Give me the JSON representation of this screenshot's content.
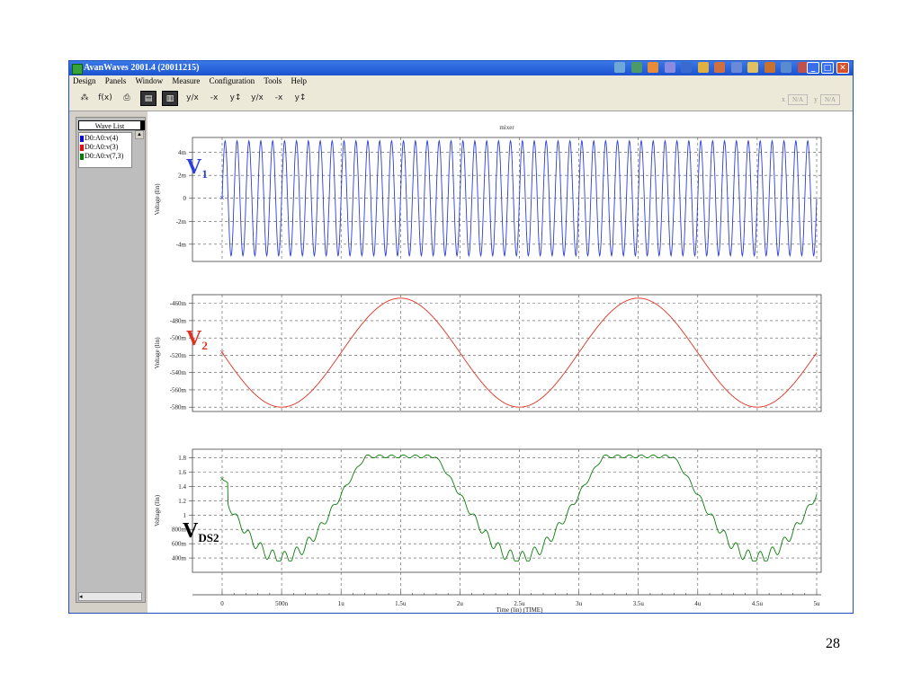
{
  "window": {
    "title": "AvanWaves 2001.4 (20011215)",
    "min_label": "_",
    "max_label": "□",
    "close_label": "✕"
  },
  "menu": [
    "Design",
    "Panels",
    "Window",
    "Measure",
    "Configuration",
    "Tools",
    "Help"
  ],
  "toolbar": {
    "icons": [
      "tree-icon",
      "function-icon",
      "print-icon",
      "export-icon",
      "import-icon",
      "cursor-y-x-icon",
      "cursor-x-icon",
      "cursor-y-icon",
      "cursor-y-x2-icon",
      "cursor-x2-icon",
      "cursor-y2-icon"
    ],
    "coord_x_label": "x",
    "coord_x_value": "N/A",
    "coord_y_label": "y",
    "coord_y_value": "N/A"
  },
  "wave_list": {
    "title": "Wave List",
    "items": [
      {
        "label": "D0:A0:v(4)",
        "color": "#0000ff"
      },
      {
        "label": "D0:A0:v(3)",
        "color": "#ff0000"
      },
      {
        "label": "D0:A0:v(7,3)",
        "color": "#008000"
      }
    ]
  },
  "chart_data": {
    "type": "line",
    "title": "mixer",
    "xlabel": "Time (lin) (TIME)",
    "xlim": [
      0,
      5
    ],
    "x_unit": "u",
    "x_ticks": [
      "0",
      "500n",
      "1u",
      "1.5u",
      "2u",
      "2.5u",
      "3u",
      "3.5u",
      "4u",
      "4.5u",
      "5u"
    ],
    "panels": [
      {
        "series": "D0:A0:v(4)",
        "annotation": "V1",
        "annotation_main": "V",
        "annotation_sub": "1",
        "color": "#2b3fd8",
        "ylabel": "Voltage (lin)",
        "yticks": [
          "4m",
          "2m",
          "0",
          "-2m",
          "-4m"
        ],
        "ylim": [
          -5.5,
          5.3
        ],
        "ytick_values": [
          4,
          2,
          0,
          -2,
          -4
        ],
        "signal": {
          "kind": "sine",
          "amplitude_mV": 5,
          "frequency_MHz": 10,
          "offset_mV": 0
        }
      },
      {
        "series": "D0:A0:v(3)",
        "annotation": "V2",
        "annotation_main": "V",
        "annotation_sub": "2",
        "color": "#e03020",
        "ylabel": "Voltage (lin)",
        "yticks": [
          "-460m",
          "-480m",
          "-500m",
          "-520m",
          "-540m",
          "-560m",
          "-580m"
        ],
        "ylim": [
          -585,
          -450
        ],
        "ytick_values": [
          -460,
          -480,
          -500,
          -520,
          -540,
          -560,
          -580
        ],
        "signal": {
          "kind": "sine",
          "center_mV": -517,
          "amplitude_mV": 63,
          "period_us": 2,
          "peak_us": 1.5
        }
      },
      {
        "series": "D0:A0:v(7,3)",
        "annotation": "VDS2",
        "annotation_main": "V",
        "annotation_sub": "DS2",
        "color": "#0a7d0a",
        "ylabel": "Voltage (lin)",
        "yticks": [
          "1.8",
          "1.6",
          "1.4",
          "1.2",
          "1",
          "800m",
          "600m",
          "400m"
        ],
        "ylim": [
          0.2,
          1.92
        ],
        "ytick_values": [
          1.8,
          1.6,
          1.4,
          1.2,
          1.0,
          0.8,
          0.6,
          0.4
        ],
        "signal": {
          "kind": "clipped-sine-with-ripple",
          "start_V": 1.5,
          "max_V": 1.82,
          "min_V": 0.36,
          "period_us": 2,
          "peak_us": 1.5,
          "ripple_MHz": 10
        }
      }
    ]
  },
  "page_number": "28"
}
